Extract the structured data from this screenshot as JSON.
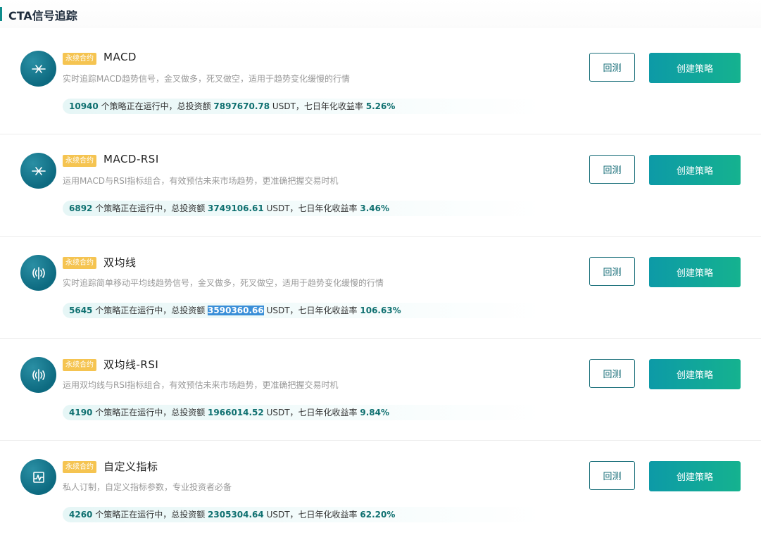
{
  "header": {
    "title": "CTA信号追踪"
  },
  "cards": [
    {
      "badge": "永续合约",
      "name": "MACD",
      "icon": "crossover-icon",
      "desc": "实时追踪MACD趋势信号，金叉做多，死叉做空，适用于趋势变化缓慢的行情",
      "running": "10940",
      "text1": " 个策略正在运行中，总投资额 ",
      "invest": "7897670.78",
      "text2": " USDT，七日年化收益率 ",
      "yield": "5.26%",
      "back_label": "回测",
      "create_label": "创建策略"
    },
    {
      "badge": "永续合约",
      "name": "MACD-RSI",
      "icon": "crossover-icon",
      "desc": "运用MACD与RSI指标组合，有效预估未来市场趋势，更准确把握交易时机",
      "running": "6892",
      "text1": " 个策略正在运行中，总投资额 ",
      "invest": "3749106.61",
      "text2": " USDT，七日年化收益率 ",
      "yield": "3.46%",
      "back_label": "回测",
      "create_label": "创建策略"
    },
    {
      "badge": "永续合约",
      "name": "双均线",
      "icon": "signal-wave-icon",
      "desc": "实时追踪简单移动平均线趋势信号，金叉做多，死叉做空，适用于趋势变化缓慢的行情",
      "running": "5645",
      "text1": " 个策略正在运行中，总投资额 ",
      "invest": "3590360.66",
      "text2": " USDT，七日年化收益率 ",
      "yield": "106.63%",
      "back_label": "回测",
      "create_label": "创建策略"
    },
    {
      "badge": "永续合约",
      "name": "双均线-RSI",
      "icon": "signal-wave-icon",
      "desc": "运用双均线与RSI指标组合，有效预估未来市场趋势，更准确把握交易时机",
      "running": "4190",
      "text1": " 个策略正在运行中，总投资额 ",
      "invest": "1966014.52",
      "text2": " USDT，七日年化收益率 ",
      "yield": "9.84%",
      "back_label": "回测",
      "create_label": "创建策略"
    },
    {
      "badge": "永续合约",
      "name": "自定义指标",
      "icon": "custom-chart-icon",
      "desc": "私人订制，自定义指标参数，专业投资者必备",
      "running": "4260",
      "text1": " 个策略正在运行中，总投资额 ",
      "invest": "2305304.64",
      "text2": " USDT，七日年化收益率 ",
      "yield": "62.20%",
      "back_label": "回测",
      "create_label": "创建策略"
    }
  ]
}
